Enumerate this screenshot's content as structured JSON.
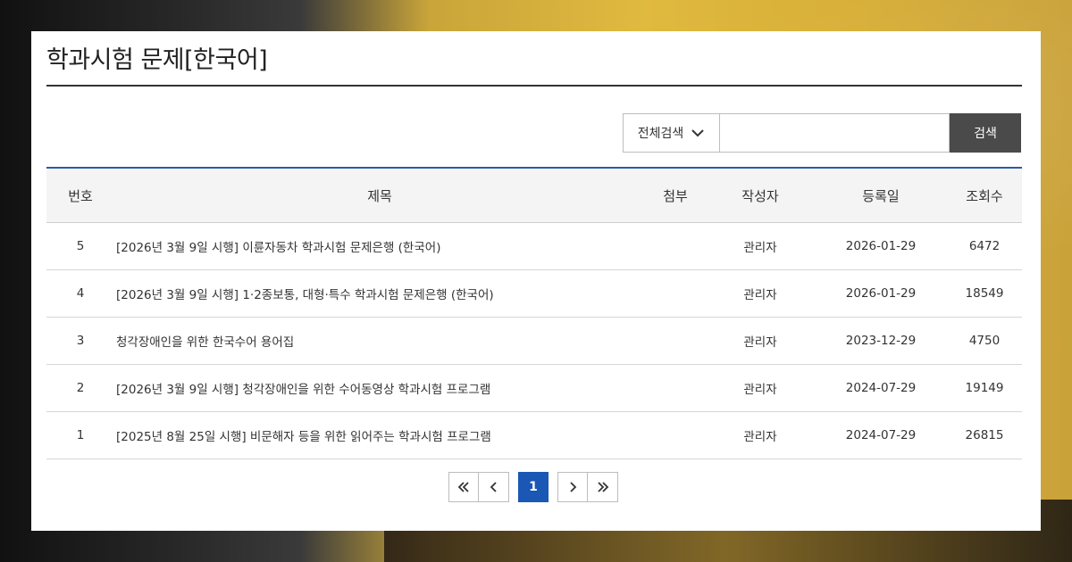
{
  "page": {
    "title": "학과시험 문제[한국어]"
  },
  "search": {
    "select_value": "전체검색",
    "input_value": "",
    "button_label": "검색"
  },
  "table": {
    "headers": [
      "번호",
      "제목",
      "첨부",
      "작성자",
      "등록일",
      "조회수"
    ],
    "rows": [
      {
        "no": "5",
        "title": "[2026년 3월 9일 시행] 이륜자동차 학과시험 문제은행 (한국어)",
        "attach": "",
        "author": "관리자",
        "date": "2026-01-29",
        "views": "6472"
      },
      {
        "no": "4",
        "title": "[2026년 3월 9일 시행] 1·2종보통, 대형·특수 학과시험 문제은행 (한국어)",
        "attach": "",
        "author": "관리자",
        "date": "2026-01-29",
        "views": "18549"
      },
      {
        "no": "3",
        "title": "청각장애인을 위한 한국수어 용어집",
        "attach": "",
        "author": "관리자",
        "date": "2023-12-29",
        "views": "4750"
      },
      {
        "no": "2",
        "title": "[2026년 3월 9일 시행] 청각장애인을 위한 수어동영상 학과시험 프로그램",
        "attach": "",
        "author": "관리자",
        "date": "2024-07-29",
        "views": "19149"
      },
      {
        "no": "1",
        "title": "[2025년 8월 25일 시행] 비문해자 등을 위한 읽어주는 학과시험 프로그램",
        "attach": "",
        "author": "관리자",
        "date": "2024-07-29",
        "views": "26815"
      }
    ]
  },
  "pagination": {
    "current": "1",
    "icons": [
      "double-chevron-left-icon",
      "chevron-left-icon",
      "chevron-right-icon",
      "double-chevron-right-icon"
    ]
  },
  "colors": {
    "accent": "#1b57b5",
    "search_button": "#4a4a4a"
  }
}
